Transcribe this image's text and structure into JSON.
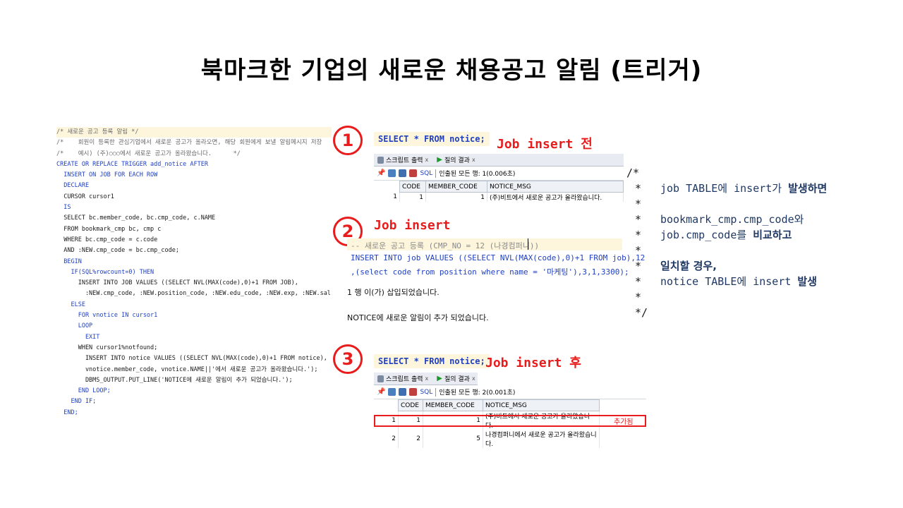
{
  "title": "북마크한 기업의 새로운 채용공고 알림 (트리거)",
  "code_lines": [
    "/* 새로운 공고 등록 알림 */",
    "/*    회원이 등록한 관심기업에서 새로운 공고가 올라오면, 해당 회원에게 보낼 알림메시지 저장",
    "/*    예시) (주)○○○에서 새로운 공고가 올라왔습니다.      */",
    "CREATE OR REPLACE TRIGGER add_notice AFTER",
    "  INSERT ON JOB FOR EACH ROW",
    "  DECLARE",
    "  CURSOR cursor1",
    "  IS",
    "  SELECT bc.member_code, bc.cmp_code, c.NAME",
    "  FROM bookmark_cmp bc, cmp c",
    "  WHERE bc.cmp_code = c.code",
    "  AND :NEW.cmp_code = bc.cmp_code;",
    "  BEGIN",
    "    IF(SQL%rowcount=0) THEN",
    "      INSERT INTO JOB VALUES ((SELECT NVL(MAX(code),0)+1 FROM JOB),",
    "        :NEW.cmp_code, :NEW.position_code, :NEW.edu_code, :NEW.exp, :NEW.sal);",
    "    ELSE",
    "      FOR vnotice IN cursor1",
    "      LOOP",
    "        EXIT",
    "      WHEN cursor1%notfound;",
    "        INSERT INTO notice VALUES ((SELECT NVL(MAX(code),0)+1 FROM notice),",
    "        vnotice.member_code, vnotice.NAME||'에서 새로운 공고가 올라왔습니다.');",
    "        DBMS_OUTPUT.PUT_LINE('NOTICE에 새로운 알림이 추가 되었습니다.');",
    "      END LOOP;",
    "    END IF;",
    "  END;"
  ],
  "step1": {
    "number": "1",
    "sql": "SELECT * FROM notice;",
    "label": "Job insert 전",
    "tab_script": "스크립트 출력",
    "tab_query": "질의 결과",
    "tab_close": "x",
    "sql_label": "SQL",
    "fetch_info": "인출된 모든 행: 1(0.006초)",
    "columns": [
      "CODE",
      "MEMBER_CODE",
      "NOTICE_MSG"
    ],
    "rows": [
      {
        "idx": "1",
        "code": "1",
        "member_code": "1",
        "msg": "(주)비트에서 새로운 공고가 올라왔습니다."
      }
    ]
  },
  "step2": {
    "number": "2",
    "label": "Job insert",
    "sql_comment": "-- 새로운 공고 등록 (CMP_NO = 12 (나경컴퍼니))",
    "sql_line1": "INSERT INTO job VALUES ((SELECT NVL(MAX(code),0)+1 FROM job),12",
    "sql_line2": ",(select code from position where name = '마케팅'),3,1,3300);",
    "output1": "1 행 이(가) 삽입되었습니다.",
    "output2": "NOTICE에 새로운 알림이 추가 되었습니다."
  },
  "step3": {
    "number": "3",
    "sql": "SELECT * FROM notice;",
    "label": "Job insert 후",
    "tab_script": "스크립트 출력",
    "tab_query": "질의 결과",
    "tab_close": "x",
    "sql_label": "SQL",
    "fetch_info": "인출된 모든 행: 2(0.001초)",
    "columns": [
      "CODE",
      "MEMBER_CODE",
      "NOTICE_MSG"
    ],
    "rows": [
      {
        "idx": "1",
        "code": "1",
        "member_code": "1",
        "msg": "(주)비트에서 새로운 공고가 올라왔습니다."
      },
      {
        "idx": "2",
        "code": "2",
        "member_code": "5",
        "msg": "나경컴퍼니에서 새로운 공고가 올라왔습니다."
      }
    ],
    "added_label": "추가됨"
  },
  "comment_block": {
    "open": "/*",
    "star": "*",
    "close": "*/",
    "line1_a": "job TABLE에 insert가 ",
    "line1_b": "발생하면",
    "line2": "bookmark_cmp.cmp_code와",
    "line3_a": "job.cmp_code를 ",
    "line3_b": "비교하고",
    "line4": "일치할 경우,",
    "line5_a": "notice TABLE에 insert ",
    "line5_b": "발생"
  },
  "colors": {
    "accent_red": "#e81c1c",
    "sql_keyword_blue": "#1f3fbf",
    "sql_highlight": "#fdf6dc",
    "comment_navy": "#1f3864"
  }
}
